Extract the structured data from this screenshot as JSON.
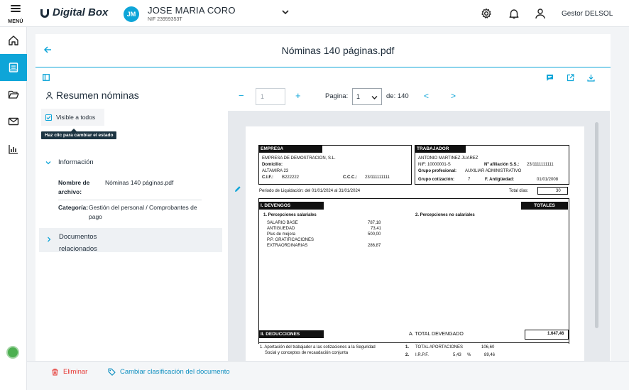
{
  "topbar": {
    "menu_label": "MENÚ",
    "logo_text": "Digital Box",
    "user_initials": "JM",
    "user_name": "JOSE MARIA CORO",
    "user_nif": "NIF 23959353T",
    "gestor_label": "Gestor DELSOL"
  },
  "colors": {
    "accent": "#0ea5d8",
    "danger": "#e53935",
    "dark": "#1c3442"
  },
  "document": {
    "title": "Nóminas 140 páginas.pdf"
  },
  "summary": {
    "title": "Resumen nóminas",
    "visible_label": "Visible a todos",
    "tooltip": "Haz clic para cambiar el estado",
    "info_label": "Información",
    "file_name_label_1": "Nombre de",
    "file_name_label_2": "archivo:",
    "file_name_value": "Nóminas 140 páginas.pdf",
    "category_label": "Categoría:",
    "category_value_1": "Gestión del personal / Comprobantes de",
    "category_value_2": "pago",
    "related_label_1": "Documentos",
    "related_label_2": "relacionados"
  },
  "pager": {
    "minus": "−",
    "page_input_value": "1",
    "plus": "+",
    "page_label": "Pagina:",
    "page_selected": "1",
    "of_label": "de: 140",
    "prev": "<",
    "next": ">"
  },
  "pdf": {
    "empresa_head": "EMPRESA",
    "empresa_name": "EMPRESA DE DEMOSTRACION, S.L.",
    "domicilio": "Domicilio:",
    "address": "ALTAMIRA 23",
    "cif_label": "C.I.F.:",
    "cif_value": "B222222",
    "ccc_label": "C.C.C.:",
    "ccc_value": "23/111111111",
    "trabajador_head": "TRABAJADOR",
    "worker_name": "ANTONIO MARTINEZ JUAREZ",
    "nif_label": "NIF: 10000001-S",
    "afil_label": "Nº afiliación S.S.:",
    "afil_value": "23/1111111111",
    "grupo_prof_label": "Grupo profesional:",
    "grupo_prof_value": "AUXILIAR ADMINISTRATIVO",
    "grupo_cot_label": "Grupo cotización:",
    "grupo_cot_value": "7",
    "antig_label": "F. Antigüedad:",
    "antig_value": "01/01/2008",
    "periodo": "Periodo de Liquidación: del     01/01/2024     al     31/01/2024",
    "total_dias_label": "Total días:",
    "total_dias_value": "30",
    "devengos_head": "I. DEVENGOS",
    "totales_head": "TOTALES",
    "perc_sal": "1. Percepciones salariales",
    "perc_no_sal": "2. Percepciones no salariales",
    "items": [
      {
        "label": "SALARIO BASE",
        "value": "787,18"
      },
      {
        "label": "ANTIGUEDAD",
        "value": "73,41"
      },
      {
        "label": "Plus de mejora",
        "value": "500,00"
      },
      {
        "label": "P.P. GRATIFICACIONES",
        "value": ""
      },
      {
        "label": "EXTRAORDINARIAS",
        "value": "286,87"
      }
    ],
    "deducciones_head": "II. DEDUCCIONES",
    "total_devengado_label": "A. TOTAL DEVENGADO",
    "total_devengado_value": "1.647,46",
    "aport_1": "1. Aportación del trabajador a las cotizaciones a la Seguridad",
    "aport_2": "Social y conceptos de recaudación conjunta",
    "ded_1_num": "1.",
    "ded_1_label": "TOTAL APORTACIONES",
    "ded_1_value": "106,60",
    "ded_2_num": "2.",
    "ded_2_label": "I.R.P.F.",
    "ded_2_pct": "5,43",
    "ded_2_pct_sign": "%",
    "ded_2_value": "89,46"
  },
  "footer": {
    "delete_label": "Eliminar",
    "reclassify_label": "Cambiar clasificación del documento"
  },
  "icons": {
    "settings": "gear-icon",
    "notifications": "bell-icon",
    "profile": "user-icon",
    "home": "home-icon",
    "documents": "documents-icon",
    "folder": "folder-icon",
    "mail": "mail-icon",
    "stats": "bar-chart-icon"
  }
}
